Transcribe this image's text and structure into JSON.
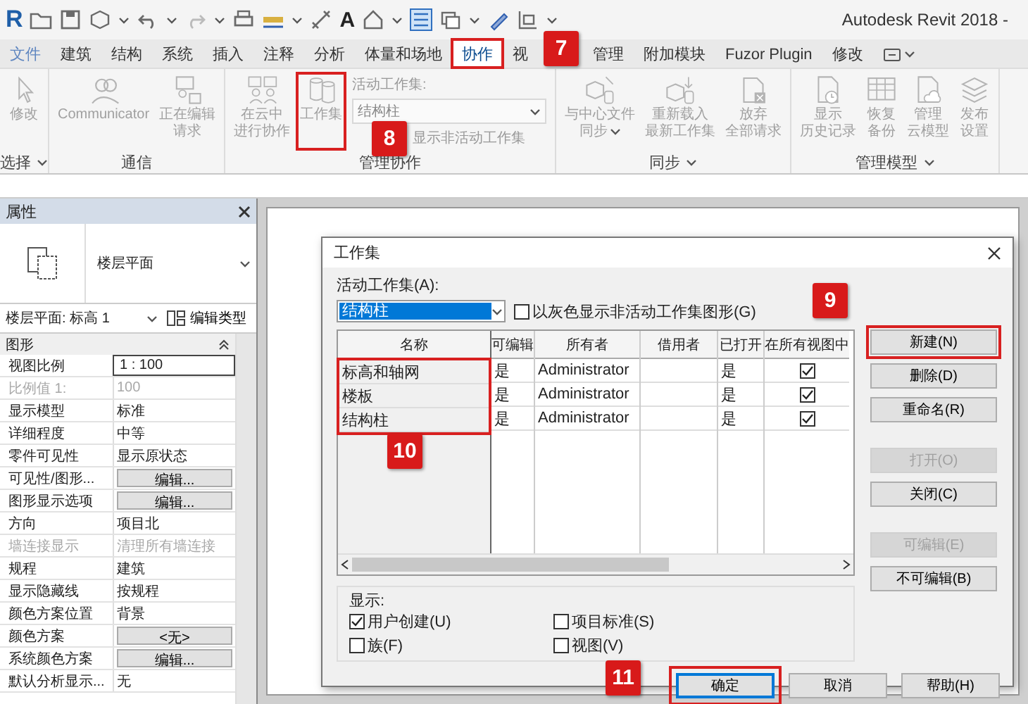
{
  "window": {
    "title": "Autodesk Revit 2018 -"
  },
  "quick_access_toolbar": {
    "logo": "R",
    "text_tool": "A"
  },
  "ribbon_tabs": [
    {
      "label": "文件",
      "kind": "file",
      "selected": false,
      "highlighted": false
    },
    {
      "label": "建筑",
      "kind": "tab",
      "selected": false,
      "highlighted": false
    },
    {
      "label": "结构",
      "kind": "tab",
      "selected": false,
      "highlighted": false
    },
    {
      "label": "系统",
      "kind": "tab",
      "selected": false,
      "highlighted": false
    },
    {
      "label": "插入",
      "kind": "tab",
      "selected": false,
      "highlighted": false
    },
    {
      "label": "注释",
      "kind": "tab",
      "selected": false,
      "highlighted": false
    },
    {
      "label": "分析",
      "kind": "tab",
      "selected": false,
      "highlighted": false
    },
    {
      "label": "体量和场地",
      "kind": "tab",
      "selected": false,
      "highlighted": false
    },
    {
      "label": "协作",
      "kind": "tab",
      "selected": true,
      "highlighted": true,
      "callout": "7"
    },
    {
      "label": "视",
      "kind": "tab",
      "selected": false,
      "highlighted": false
    },
    {
      "label": "管理",
      "kind": "tab",
      "selected": false,
      "highlighted": false
    },
    {
      "label": "附加模块",
      "kind": "tab",
      "selected": false,
      "highlighted": false
    },
    {
      "label": "Fuzor Plugin",
      "kind": "tab",
      "selected": false,
      "highlighted": false
    },
    {
      "label": "修改",
      "kind": "tab",
      "selected": false,
      "highlighted": false
    },
    {
      "kind": "menu",
      "selected": false,
      "highlighted": false
    }
  ],
  "ribbon_panels": [
    {
      "title": "选择",
      "dropdown": true,
      "items": [
        {
          "kind": "button",
          "label_lines": [
            "修改"
          ],
          "dropdown": false,
          "highlighted": false
        }
      ]
    },
    {
      "title": "通信",
      "dropdown": false,
      "items": [
        {
          "kind": "button",
          "label_lines": [
            "Communicator"
          ],
          "dropdown": false,
          "highlighted": false
        },
        {
          "kind": "button",
          "label_lines": [
            "正在编辑",
            "请求"
          ],
          "dropdown": false,
          "highlighted": false
        }
      ]
    },
    {
      "title": "管理协作",
      "dropdown": false,
      "items": [
        {
          "kind": "button",
          "label_lines": [
            "在云中",
            "进行协作"
          ],
          "dropdown": false,
          "highlighted": false
        },
        {
          "kind": "button",
          "label_lines": [
            "工作集"
          ],
          "dropdown": false,
          "highlighted": true
        },
        {
          "kind": "workset_selector",
          "label": "活动工作集:",
          "value": "结构柱",
          "checkbox_label": "显示非活动工作集",
          "callout": "8"
        }
      ]
    },
    {
      "title": "同步",
      "dropdown": true,
      "items": [
        {
          "kind": "button",
          "label_lines": [
            "与中心文件",
            "同步"
          ],
          "dropdown": true,
          "highlighted": false
        },
        {
          "kind": "button",
          "label_lines": [
            "重新载入",
            "最新工作集"
          ],
          "dropdown": false,
          "highlighted": false
        },
        {
          "kind": "button",
          "label_lines": [
            "放弃",
            "全部请求"
          ],
          "dropdown": false,
          "highlighted": false
        }
      ]
    },
    {
      "title": "管理模型",
      "dropdown": true,
      "items": [
        {
          "kind": "button",
          "label_lines": [
            "显示",
            "历史记录"
          ],
          "dropdown": false,
          "highlighted": false
        },
        {
          "kind": "button",
          "label_lines": [
            "恢复",
            "备份"
          ],
          "dropdown": false,
          "highlighted": false
        },
        {
          "kind": "button",
          "label_lines": [
            "管理",
            "云模型"
          ],
          "dropdown": false,
          "highlighted": false
        },
        {
          "kind": "button",
          "label_lines": [
            "发布",
            "设置"
          ],
          "dropdown": false,
          "highlighted": false
        }
      ]
    }
  ],
  "properties_palette": {
    "title": "属性",
    "type_name": "楼层平面",
    "instance_selector": "楼层平面: 标高 1",
    "edit_type_button": "编辑类型",
    "group": {
      "label": "图形",
      "expanded": true
    },
    "rows": [
      {
        "name": "视图比例",
        "value": "1 : 100",
        "kind": "input"
      },
      {
        "name": "比例值 1:",
        "value": "100",
        "kind": "readonly"
      },
      {
        "name": "显示模型",
        "value": "标准",
        "kind": "text"
      },
      {
        "name": "详细程度",
        "value": "中等",
        "kind": "text"
      },
      {
        "name": "零件可见性",
        "value": "显示原状态",
        "kind": "text"
      },
      {
        "name": "可见性/图形...",
        "value": "编辑...",
        "kind": "button"
      },
      {
        "name": "图形显示选项",
        "value": "编辑...",
        "kind": "button"
      },
      {
        "name": "方向",
        "value": "项目北",
        "kind": "text"
      },
      {
        "name": "墙连接显示",
        "value": "清理所有墙连接",
        "kind": "readonly"
      },
      {
        "name": "规程",
        "value": "建筑",
        "kind": "text"
      },
      {
        "name": "显示隐藏线",
        "value": "按规程",
        "kind": "text"
      },
      {
        "name": "颜色方案位置",
        "value": "背景",
        "kind": "text"
      },
      {
        "name": "颜色方案",
        "value": "<无>",
        "kind": "button"
      },
      {
        "name": "系统颜色方案",
        "value": "编辑...",
        "kind": "button"
      },
      {
        "name": "默认分析显示...",
        "value": "无",
        "kind": "text"
      }
    ]
  },
  "dialog": {
    "title": "工作集",
    "active_workset_label": "活动工作集(A):",
    "active_workset": "结构柱",
    "gray_inactive": {
      "label": "以灰色显示非活动工作集图形(G)",
      "checked": false
    },
    "table": {
      "name_column": "名称",
      "columns": [
        "可编辑",
        "所有者",
        "借用者",
        "已打开",
        "在所有视图中"
      ],
      "names_highlighted": true,
      "callout": "10",
      "rows": [
        {
          "name": "标高和轴网",
          "editable": "是",
          "owner": "Administrator",
          "opened": "是",
          "visible_in_all_views": true
        },
        {
          "name": "楼板",
          "editable": "是",
          "owner": "Administrator",
          "opened": "是",
          "visible_in_all_views": true
        },
        {
          "name": "结构柱",
          "editable": "是",
          "owner": "Administrator",
          "opened": "是",
          "visible_in_all_views": true
        }
      ]
    },
    "side_buttons": [
      {
        "label": "新建(N)",
        "disabled": false,
        "highlighted": true,
        "callout": "9"
      },
      {
        "label": "删除(D)",
        "disabled": false,
        "highlighted": false
      },
      {
        "label": "重命名(R)",
        "disabled": false,
        "highlighted": false
      },
      {
        "label": "打开(O)",
        "disabled": true,
        "highlighted": false
      },
      {
        "label": "关闭(C)",
        "disabled": false,
        "highlighted": false
      },
      {
        "label": "可编辑(E)",
        "disabled": true,
        "highlighted": false
      },
      {
        "label": "不可编辑(B)",
        "disabled": false,
        "highlighted": false
      }
    ],
    "display": {
      "label": "显示:",
      "options": [
        {
          "label": "用户创建(U)",
          "checked": true
        },
        {
          "label": "项目标准(S)",
          "checked": false
        },
        {
          "label": "族(F)",
          "checked": false
        },
        {
          "label": "视图(V)",
          "checked": false
        }
      ]
    },
    "footer_buttons": [
      {
        "label": "确定",
        "default": true,
        "highlighted": true,
        "callout": "11"
      },
      {
        "label": "取消",
        "default": false,
        "highlighted": false
      },
      {
        "label": "帮助(H)",
        "default": false,
        "highlighted": false
      }
    ]
  }
}
